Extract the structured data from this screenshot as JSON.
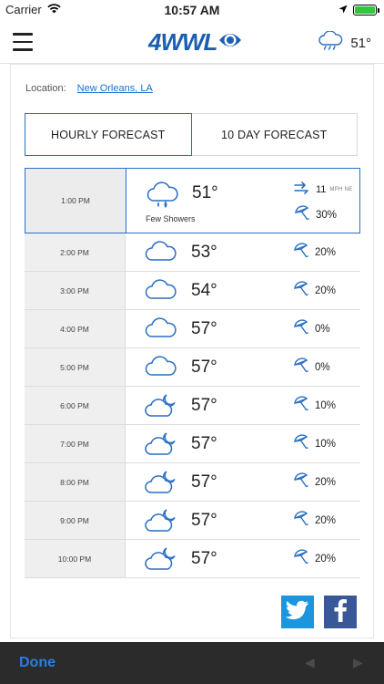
{
  "status_bar": {
    "carrier": "Carrier",
    "time": "10:57 AM"
  },
  "header": {
    "logo": "4WWL",
    "current_temp": "51°"
  },
  "location": {
    "label": "Location:",
    "value": "New Orleans, LA"
  },
  "tabs": [
    {
      "label": "HOURLY FORECAST",
      "active": true
    },
    {
      "label": "10 DAY FORECAST",
      "active": false
    }
  ],
  "hourly": [
    {
      "time": "1:00 PM",
      "temp": "51°",
      "icon": "cloud-rain-icon",
      "condition": "Few Showers",
      "wind_speed": "11",
      "wind_unit": "MPH NE",
      "precip": "30%"
    },
    {
      "time": "2:00 PM",
      "temp": "53°",
      "icon": "cloud-icon",
      "precip": "20%"
    },
    {
      "time": "3:00 PM",
      "temp": "54°",
      "icon": "cloud-icon",
      "precip": "20%"
    },
    {
      "time": "4:00 PM",
      "temp": "57°",
      "icon": "cloud-icon",
      "precip": "0%"
    },
    {
      "time": "5:00 PM",
      "temp": "57°",
      "icon": "cloud-icon",
      "precip": "0%"
    },
    {
      "time": "6:00 PM",
      "temp": "57°",
      "icon": "cloud-moon-icon",
      "precip": "10%"
    },
    {
      "time": "7:00 PM",
      "temp": "57°",
      "icon": "cloud-moon-icon",
      "precip": "10%"
    },
    {
      "time": "8:00 PM",
      "temp": "57°",
      "icon": "cloud-moon-icon",
      "precip": "20%"
    },
    {
      "time": "9:00 PM",
      "temp": "57°",
      "icon": "cloud-moon-icon",
      "precip": "20%"
    },
    {
      "time": "10:00 PM",
      "temp": "57°",
      "icon": "cloud-moon-icon",
      "precip": "20%"
    }
  ],
  "toolbar": {
    "done_label": "Done",
    "back_arrow": "◀",
    "forward_arrow": "▶"
  },
  "colors": {
    "accent": "#2a6fc2",
    "logo": "#1b5fb0",
    "twitter": "#1c95de",
    "facebook": "#3a5897",
    "toolbar_bg": "#2b2b2b"
  }
}
